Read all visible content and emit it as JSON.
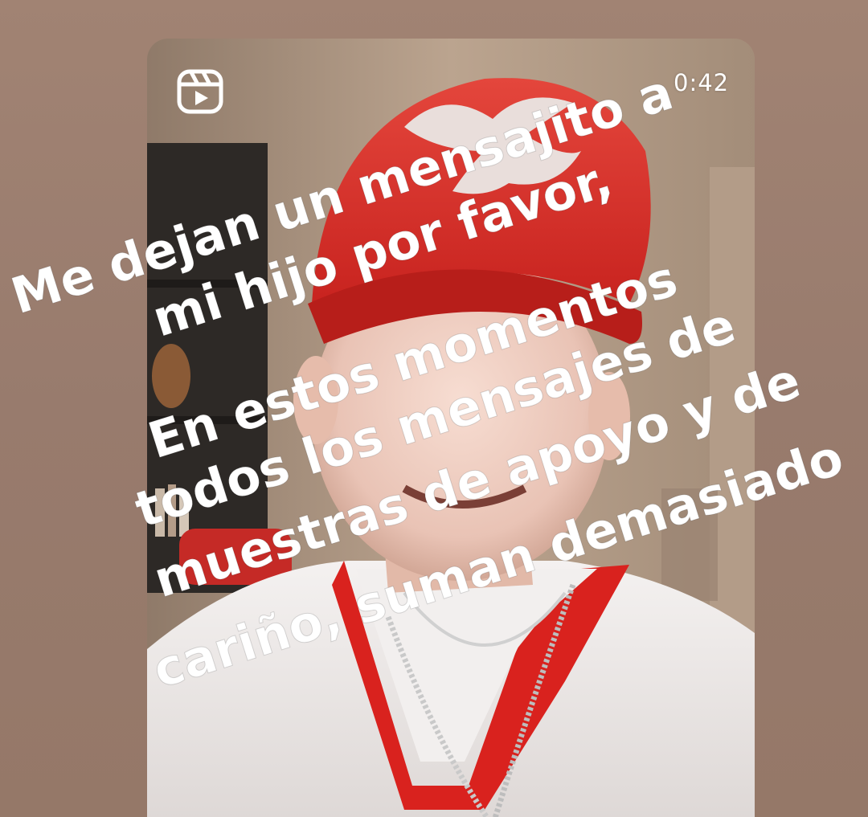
{
  "story": {
    "reels_icon": "reels-icon",
    "duration": "0:42",
    "overlay_text": {
      "lines": [
        "Me dejan un mensajito a",
        "mi hijo por favor,",
        "En estos momentos",
        "todos los mensajes de",
        "muestras de apoyo y de",
        "cariño, suman demasiado"
      ],
      "color": "#ffffff",
      "rotation_deg": -17.5
    },
    "colors": {
      "background": "#9a7d70",
      "cap_red": "#e0312a",
      "shirt_white": "#f2efee",
      "collar_red": "#d9221e"
    }
  }
}
